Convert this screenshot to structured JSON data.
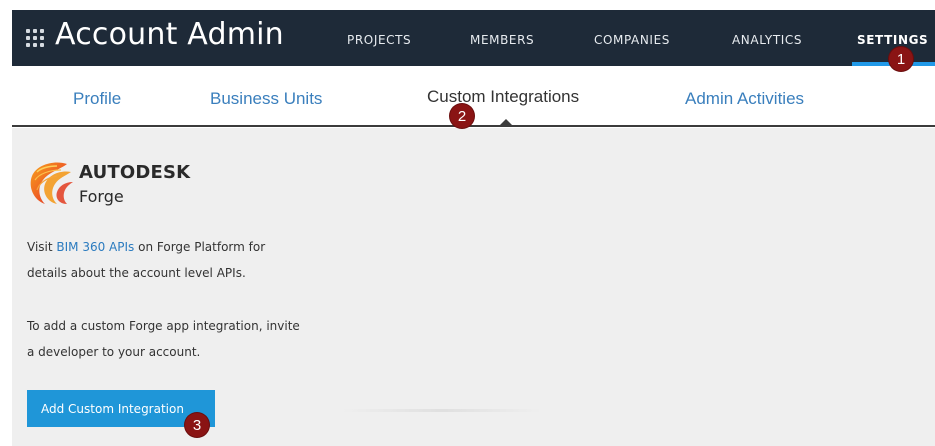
{
  "header": {
    "app_title": "Account Admin",
    "nav": [
      {
        "label": "PROJECTS"
      },
      {
        "label": "MEMBERS"
      },
      {
        "label": "COMPANIES"
      },
      {
        "label": "ANALYTICS"
      },
      {
        "label": "SETTINGS",
        "active": true
      }
    ]
  },
  "subnav": {
    "tabs": [
      {
        "label": "Profile"
      },
      {
        "label": "Business Units"
      },
      {
        "label": "Custom Integrations",
        "active": true
      },
      {
        "label": "Admin Activities"
      }
    ]
  },
  "forge": {
    "brand": "AUTODESK",
    "product": "Forge",
    "visit_prefix": "Visit ",
    "visit_link": "BIM 360 APIs",
    "visit_suffix": " on Forge Platform for",
    "visit_line2": "details about the account level APIs.",
    "invite_line1": "To add a custom Forge app integration, invite",
    "invite_line2": "a developer to your account.",
    "add_button": "Add Custom Integration"
  },
  "markers": [
    "1",
    "2",
    "3"
  ],
  "colors": {
    "topbar": "#1e2a38",
    "accent": "#2199e8",
    "button": "#1f96d8",
    "link": "#3a7fbd",
    "marker": "#8a1414",
    "panel": "#efefef"
  },
  "icons": {
    "apps": "grid-icon",
    "logo": "autodesk-forge-logo"
  }
}
